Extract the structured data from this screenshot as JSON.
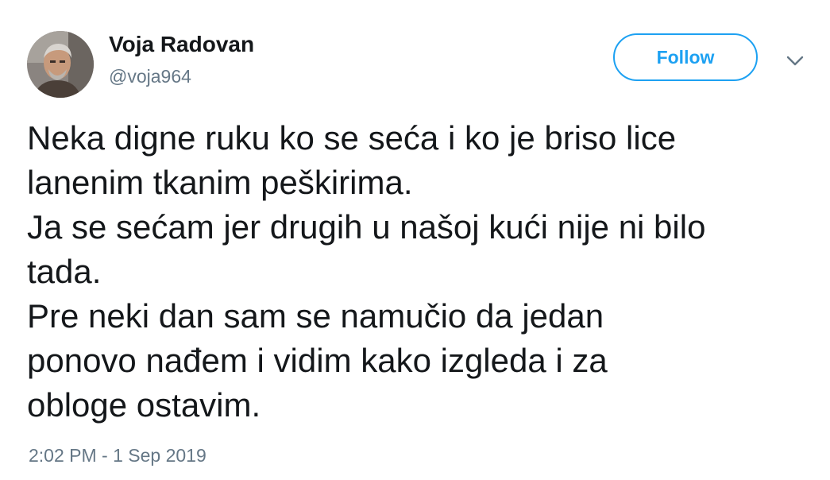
{
  "author": {
    "name": "Voja Radovan",
    "handle": "@voja964"
  },
  "follow_button": {
    "label": "Follow"
  },
  "caret": {
    "icon": "chevron-down-icon"
  },
  "tweet": {
    "lines": [
      "Neka digne ruku ko se seća i ko je briso lice",
      "lanenim tkanim peškirima.",
      "Ja se sećam jer drugih u našoj kući nije ni bilo",
      "tada.",
      "Pre neki dan sam se namučio da jedan",
      "ponovo nađem i vidim kako izgleda i za",
      "obloge ostavim."
    ],
    "timestamp": "2:02 PM - 1 Sep 2019"
  },
  "colors": {
    "accent": "#1da1f2",
    "text": "#14171a",
    "secondary": "#657786"
  }
}
